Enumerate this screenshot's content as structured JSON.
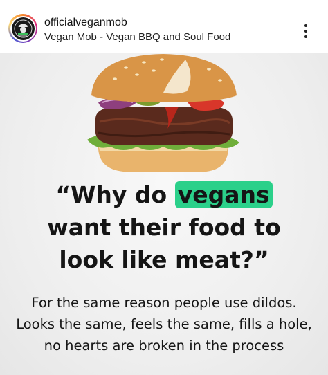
{
  "post": {
    "account_name": "officialveganmob",
    "subtitle": "Vegan Mob - Vegan BBQ and Soul Food",
    "more_icon": "more-vertical-icon"
  },
  "image": {
    "headline_open": "“Why do ",
    "headline_highlight": "vegans",
    "headline_line2": "want their food to",
    "headline_line3": "look like meat?”",
    "body": "For the same reason people use dildos. Looks the same, feels the same, fills a hole, no hearts are broken in the process",
    "highlight_color": "#2bd08a"
  }
}
